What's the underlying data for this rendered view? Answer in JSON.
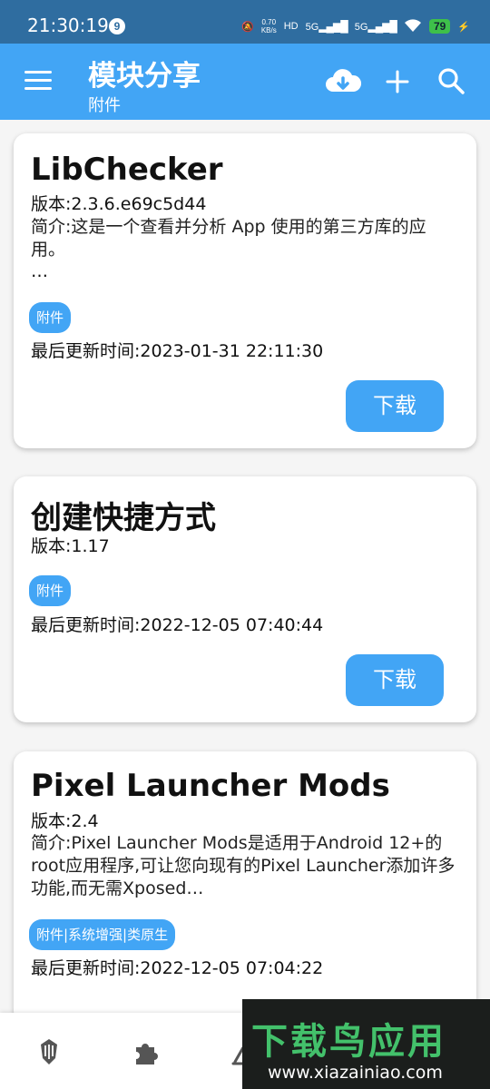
{
  "status_bar": {
    "time": "21:30:19",
    "notification_count": "9",
    "net_speed_value": "0.70",
    "net_speed_unit": "KB/s",
    "hd_label": "HD",
    "signal_1": "5G",
    "signal_2": "5G",
    "battery": "79"
  },
  "app_bar": {
    "title": "模块分享",
    "subtitle": "附件",
    "icons": [
      "menu-icon",
      "cloud-download-icon",
      "plus-icon",
      "search-icon"
    ]
  },
  "cards": [
    {
      "title": "LibChecker",
      "version": "版本:2.3.6.e69c5d44",
      "description": "简介:这是一个查看并分析 App 使用的第三方库的应用。",
      "ellipsis": "…",
      "tag": "附件",
      "updated": "最后更新时间:2023-01-31 22:11:30",
      "button": "下载"
    },
    {
      "title": "创建快捷方式",
      "version": "版本:1.17",
      "tag": "附件",
      "updated": "最后更新时间:2022-12-05 07:40:44",
      "button": "下载"
    },
    {
      "title": "Pixel Launcher Mods",
      "version": "版本:2.4",
      "description": "简介:Pixel Launcher Mods是适用于Android 12+的root应用程序,可让您向现有的Pixel Launcher添加许多功能,而无需Xposed…",
      "tag": "附件|系统增强|类原生",
      "updated": "最后更新时间:2022-12-05 07:04:22"
    }
  ],
  "bottom_nav": {
    "icons": [
      "magisk-icon",
      "puzzle-icon",
      "chart-icon"
    ]
  },
  "watermark": {
    "text": "下载鸟应用",
    "url": "www.xiazainiao.com"
  },
  "colors": {
    "accent": "#42a5f5",
    "status_bar": "#2f6da0",
    "background": "#f5f5f5"
  }
}
